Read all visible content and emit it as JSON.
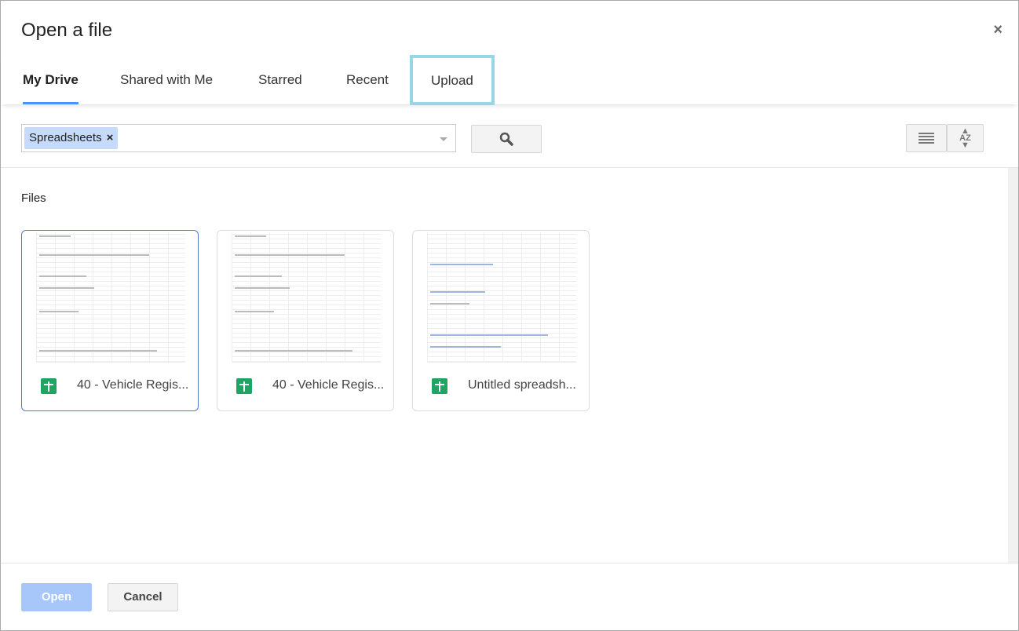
{
  "dialog": {
    "title": "Open a file",
    "close": "×"
  },
  "tabs": [
    {
      "label": "My Drive",
      "active": true
    },
    {
      "label": "Shared with Me"
    },
    {
      "label": "Starred"
    },
    {
      "label": "Recent"
    },
    {
      "label": "Upload",
      "highlighted": true
    }
  ],
  "search": {
    "chip": "Spreadsheets",
    "chip_remove": "×",
    "icon": "search-icon"
  },
  "view": {
    "list_icon": "list-view-icon",
    "sort_icon": "sort-az-icon",
    "sort_text": "AZ"
  },
  "files": {
    "label": "Files",
    "items": [
      {
        "name": "40 - Vehicle Regis...",
        "type": "spreadsheet",
        "selected": true
      },
      {
        "name": "40 - Vehicle Regis...",
        "type": "spreadsheet"
      },
      {
        "name": "Untitled spreadsh...",
        "type": "spreadsheet"
      }
    ]
  },
  "footer": {
    "open": "Open",
    "cancel": "Cancel"
  },
  "colors": {
    "accent": "#4d90fe",
    "highlight": "#97d6e6",
    "chip": "#c6dafc",
    "sheets": "#1fa463"
  }
}
